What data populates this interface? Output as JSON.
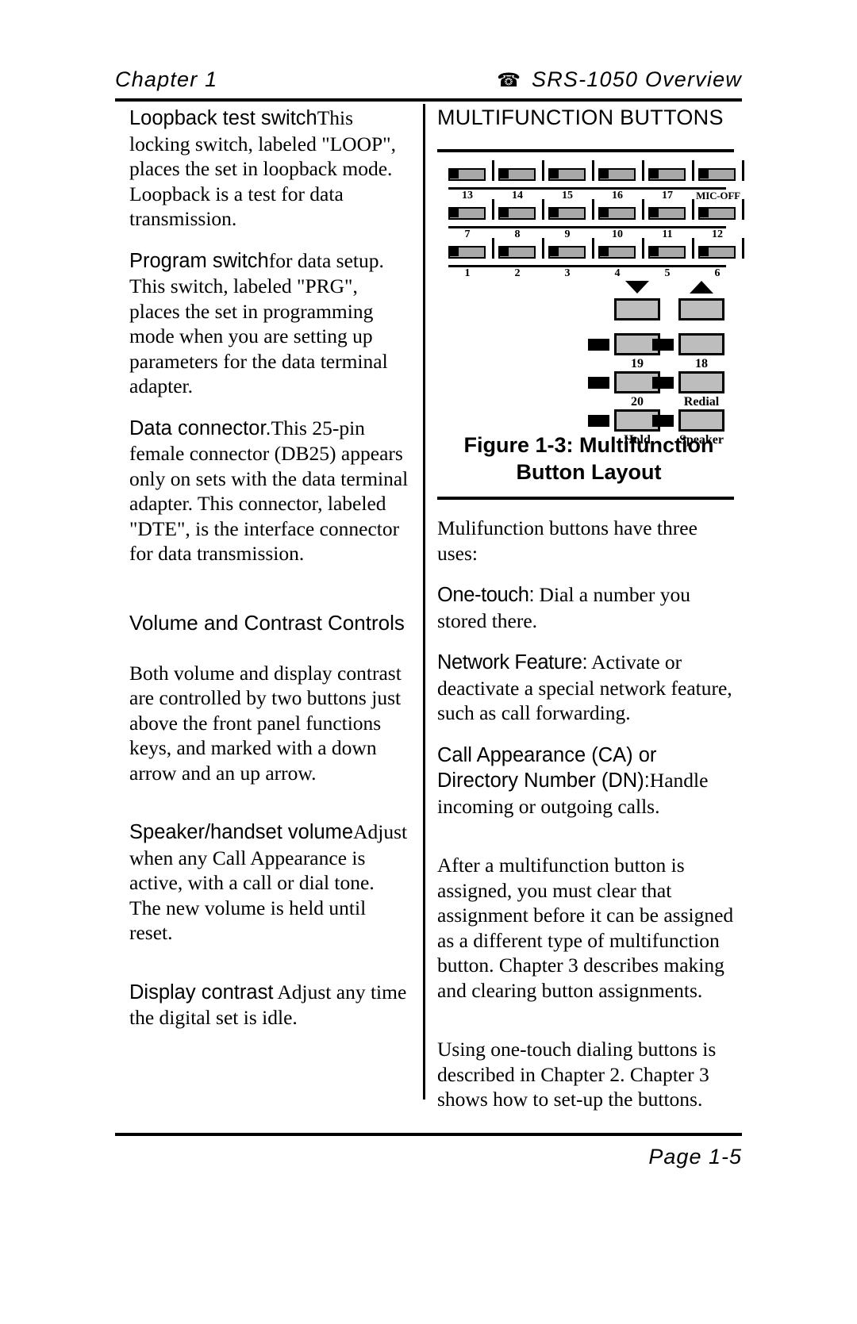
{
  "header": {
    "chapter": "Chapter 1",
    "phone_icon": "☎",
    "title": "SRS-1050 Overview"
  },
  "left_column": {
    "paragraphs": [
      {
        "term": "Loopback test switch",
        "body": "This locking switch, labeled \"LOOP\", places the set in loopback mode.  Loopback is a test for data transmission."
      },
      {
        "term": "Program switch",
        "body": "for data setup.  This switch, labeled \"PRG\", places the set in programming mode when you are setting up parameters for the data terminal adapter."
      },
      {
        "term": "Data connector.",
        "body": "This 25-pin female connector (DB25) appears only on sets with the data terminal adapter.  This connector, labeled \"DTE\", is the interface connector for data transmission."
      }
    ],
    "section_heading": "Volume and Contrast Controls",
    "section_paragraph": "Both volume and display contrast are controlled by two buttons just above the front panel functions keys, and marked with a down arrow and an up arrow.",
    "sub_paragraphs": [
      {
        "term": "Speaker/handset volume",
        "body": "Adjust when any Call Appearance is active, with a call or dial tone.  The new volume is held until reset."
      },
      {
        "term": "Display contrast",
        "body": "Adjust any time the digital set is idle."
      }
    ]
  },
  "right_column": {
    "heading": "MULTIFUNCTION BUTTONS",
    "figure": {
      "caption_line1": "Figure 1-3:  Multifunction",
      "caption_line2": "Button Layout",
      "row_top_labels": [
        "13",
        "14",
        "15",
        "16",
        "17",
        "MIC-OFF"
      ],
      "row_mid_labels": [
        "7",
        "8",
        "9",
        "10",
        "11",
        "12"
      ],
      "row_bot_labels": [
        "1",
        "2",
        "3",
        "4",
        "5",
        "6"
      ],
      "volume_down_icon": "down-arrow",
      "volume_up_icon": "up-arrow",
      "function_keys": [
        {
          "label": "19"
        },
        {
          "label": "18"
        },
        {
          "label": "20"
        },
        {
          "label": "Redial"
        },
        {
          "label": "Hold"
        },
        {
          "label": "Speaker"
        }
      ],
      "button_face_color": "#b5b5b5",
      "outline_color": "#000000"
    },
    "intro_paragraph": "Mulifunction buttons have three uses:",
    "uses": [
      {
        "term": "One-touch:",
        "body": "Dial a number you stored there."
      },
      {
        "term": "Network Feature:",
        "body": "Activate or deactivate a special network feature, such as call forwarding."
      },
      {
        "term": "Call Appearance (CA) or Directory Number (DN):",
        "body": "Handle incoming or outgoing calls."
      }
    ],
    "paragraphs": [
      "After a multifunction button is assigned, you must clear that assignment before it can be assigned as a different type of multifunction button.  Chapter 3 describes making and clearing button assignments.",
      "Using one-touch dialing buttons is described in Chapter 2.  Chapter 3 shows how to set-up the buttons."
    ]
  },
  "footer": {
    "page_label": "Page 1-5"
  }
}
